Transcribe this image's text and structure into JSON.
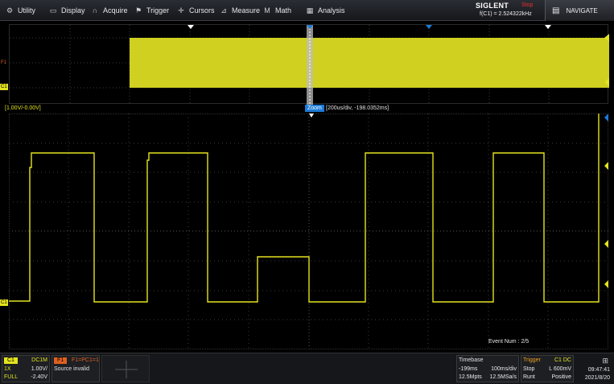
{
  "menu": [
    {
      "label": "Utility",
      "icon": "wrench-icon"
    },
    {
      "label": "Display",
      "icon": "monitor-icon"
    },
    {
      "label": "Acquire",
      "icon": "acquire-icon"
    },
    {
      "label": "Trigger",
      "icon": "flag-icon"
    },
    {
      "label": "Cursors",
      "icon": "crosshair-icon"
    },
    {
      "label": "Measure",
      "icon": "ruler-icon"
    },
    {
      "label": "Math",
      "icon": "math-icon"
    },
    {
      "label": "Analysis",
      "icon": "analysis-icon"
    }
  ],
  "brand": {
    "name": "SIGLENT",
    "run_state": "Stop",
    "frequency": "f(C1) = 2.524322kHz"
  },
  "navigate": {
    "label": "NAVIGATE"
  },
  "channel_scale": "[1.00V/-0.00V]",
  "zoom": {
    "tag": "Zoom",
    "info": "[200us/div, -198.0352ms]"
  },
  "event_num": "Event Num : 2/5",
  "markers": {
    "f1": "F1",
    "c1": "C1"
  },
  "c1": {
    "tag": "C1",
    "coupling": "DC1M",
    "probe": "1X",
    "vdiv": "1.00V/",
    "bw": "FULL",
    "offset": "-2.40V"
  },
  "f1": {
    "tag": "F1",
    "expr": "F1=PC1=1",
    "status": "Source invalid"
  },
  "timebase": {
    "head": "Timebase",
    "delay": "-199ms",
    "tdiv": "100ms/div",
    "mpts": "12.5Mpts",
    "srate": "12.5MSa/s"
  },
  "trigger": {
    "head": "Trigger",
    "source": "C1 DC",
    "mode": "Stop",
    "level": "L 600mV",
    "type": "Runt",
    "slope": "Positive"
  },
  "clock": {
    "time": "09:47:41",
    "date": "2021/8/20"
  },
  "colors": {
    "trace": "#e4e31f",
    "math": "#e06020",
    "zoom": "#1c7ad6",
    "trigger_label": "#f0a020",
    "stop": "#e83030"
  }
}
